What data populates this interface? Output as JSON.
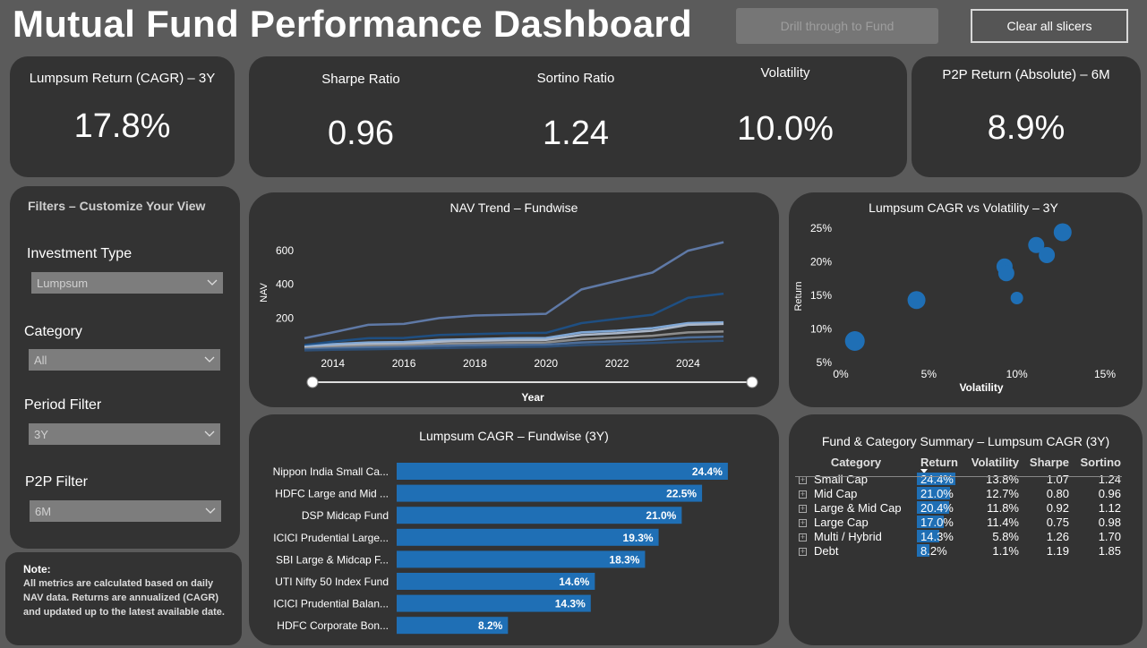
{
  "header": {
    "title": "Mutual Fund Performance Dashboard",
    "drill_label": "Drill through to Fund",
    "clear_label": "Clear all slicers"
  },
  "kpis": {
    "lumpsum_label": "Lumpsum Return (CAGR) – 3Y",
    "lumpsum_value": "17.8%",
    "sharpe_label": "Sharpe Ratio",
    "sharpe_value": "0.96",
    "sortino_label": "Sortino Ratio",
    "sortino_value": "1.24",
    "volatility_label": "Volatility",
    "volatility_value": "10.0%",
    "p2p_label": "P2P Return (Absolute) – 6M",
    "p2p_value": "8.9%"
  },
  "filters": {
    "heading": "Filters – Customize Your View",
    "investment_type_label": "Investment Type",
    "investment_type_value": "Lumpsum",
    "category_label": "Category",
    "category_value": "All",
    "period_label": "Period Filter",
    "period_value": "3Y",
    "p2p_label": "P2P Filter",
    "p2p_value": "6M"
  },
  "note": {
    "heading": "Note:",
    "text": "All metrics are calculated based on daily NAV data. Returns are annualized (CAGR) and updated up to the latest available date."
  },
  "colors": {
    "card": "#333333",
    "background": "#5b5b5b",
    "bar": "#1f6fb5",
    "scatter": "#1f6fb5"
  },
  "chart_data": [
    {
      "id": "nav_trend",
      "type": "line",
      "title": "NAV Trend – Fundwise",
      "xlabel": "Year",
      "ylabel": "NAV",
      "x_ticks": [
        "2014",
        "2016",
        "2018",
        "2020",
        "2022",
        "2024"
      ],
      "y_ticks": [
        200,
        400,
        600
      ],
      "xlim": [
        2013.2,
        2025.2
      ],
      "ylim": [
        0,
        680
      ],
      "x": [
        2013.2,
        2014,
        2015,
        2016,
        2017,
        2018,
        2019,
        2020,
        2021,
        2022,
        2023,
        2024,
        2025
      ],
      "series": [
        {
          "values": [
            80,
            115,
            160,
            165,
            200,
            215,
            220,
            225,
            370,
            420,
            470,
            600,
            650
          ],
          "color": "#5f79a6"
        },
        {
          "values": [
            40,
            60,
            80,
            82,
            100,
            105,
            110,
            112,
            170,
            195,
            220,
            320,
            345
          ],
          "color": "#1f4f82"
        },
        {
          "values": [
            30,
            45,
            55,
            58,
            70,
            75,
            80,
            82,
            115,
            125,
            140,
            170,
            175
          ],
          "color": "#7fa7d6"
        },
        {
          "values": [
            25,
            35,
            45,
            48,
            60,
            65,
            68,
            70,
            100,
            110,
            125,
            160,
            165
          ],
          "color": "#aab6c8"
        },
        {
          "values": [
            20,
            28,
            35,
            38,
            45,
            50,
            52,
            55,
            75,
            85,
            95,
            115,
            120
          ],
          "color": "#8d8d8d"
        },
        {
          "values": [
            15,
            20,
            25,
            28,
            35,
            38,
            40,
            42,
            55,
            62,
            70,
            85,
            90
          ],
          "color": "#4c6d99"
        },
        {
          "values": [
            8,
            12,
            15,
            18,
            22,
            25,
            28,
            30,
            40,
            45,
            52,
            60,
            65
          ],
          "color": "#2e4f76"
        }
      ]
    },
    {
      "id": "cagr_vs_vol",
      "type": "scatter",
      "title": "Lumpsum CAGR vs Volatility – 3Y",
      "xlabel": "Volatility",
      "ylabel": "Return",
      "x_ticks": [
        "0%",
        "5%",
        "10%",
        "15%"
      ],
      "y_ticks": [
        "5%",
        "10%",
        "15%",
        "20%",
        "25%"
      ],
      "xlim": [
        0,
        15
      ],
      "ylim": [
        5,
        25
      ],
      "points": [
        {
          "x": 0.8,
          "y": 8.2,
          "size": 11
        },
        {
          "x": 4.3,
          "y": 14.3,
          "size": 10
        },
        {
          "x": 9.3,
          "y": 19.3,
          "size": 9
        },
        {
          "x": 9.4,
          "y": 18.3,
          "size": 9
        },
        {
          "x": 10.0,
          "y": 14.6,
          "size": 7
        },
        {
          "x": 11.1,
          "y": 22.5,
          "size": 9
        },
        {
          "x": 11.7,
          "y": 21.0,
          "size": 9
        },
        {
          "x": 12.6,
          "y": 24.4,
          "size": 10
        }
      ]
    },
    {
      "id": "cagr_fundwise",
      "type": "bar",
      "title": "Lumpsum CAGR – Fundwise (3Y)",
      "categories": [
        "Nippon India Small Ca...",
        "HDFC Large and Mid ...",
        "DSP Midcap Fund",
        "ICICI Prudential Large...",
        "SBI Large & Midcap F...",
        "UTI Nifty 50 Index Fund",
        "ICICI Prudential Balan...",
        "HDFC Corporate Bon..."
      ],
      "values": [
        24.4,
        22.5,
        21.0,
        19.3,
        18.3,
        14.6,
        14.3,
        8.2
      ],
      "labels": [
        "24.4%",
        "22.5%",
        "21.0%",
        "19.3%",
        "18.3%",
        "14.6%",
        "14.3%",
        "8.2%"
      ],
      "xlim": [
        0,
        25
      ]
    },
    {
      "id": "summary",
      "type": "table",
      "title": "Fund & Category Summary – Lumpsum CAGR (3Y)",
      "columns": [
        "Category",
        "Return",
        "Volatility",
        "Sharpe",
        "Sortino"
      ],
      "rows": [
        {
          "category": "Small Cap",
          "return": "24.4%",
          "return_value": 24.4,
          "volatility": "13.8%",
          "sharpe": "1.07",
          "sortino": "1.24"
        },
        {
          "category": "Mid Cap",
          "return": "21.0%",
          "return_value": 21.0,
          "volatility": "12.7%",
          "sharpe": "0.80",
          "sortino": "0.96"
        },
        {
          "category": "Large & Mid Cap",
          "return": "20.4%",
          "return_value": 20.4,
          "volatility": "11.8%",
          "sharpe": "0.92",
          "sortino": "1.12"
        },
        {
          "category": "Large Cap",
          "return": "17.0%",
          "return_value": 17.0,
          "volatility": "11.4%",
          "sharpe": "0.75",
          "sortino": "0.98"
        },
        {
          "category": "Multi / Hybrid",
          "return": "14.3%",
          "return_value": 14.3,
          "volatility": "5.8%",
          "sharpe": "1.26",
          "sortino": "1.70"
        },
        {
          "category": "Debt",
          "return": "8.2%",
          "return_value": 8.2,
          "volatility": "1.1%",
          "sharpe": "1.19",
          "sortino": "1.85"
        }
      ]
    }
  ]
}
